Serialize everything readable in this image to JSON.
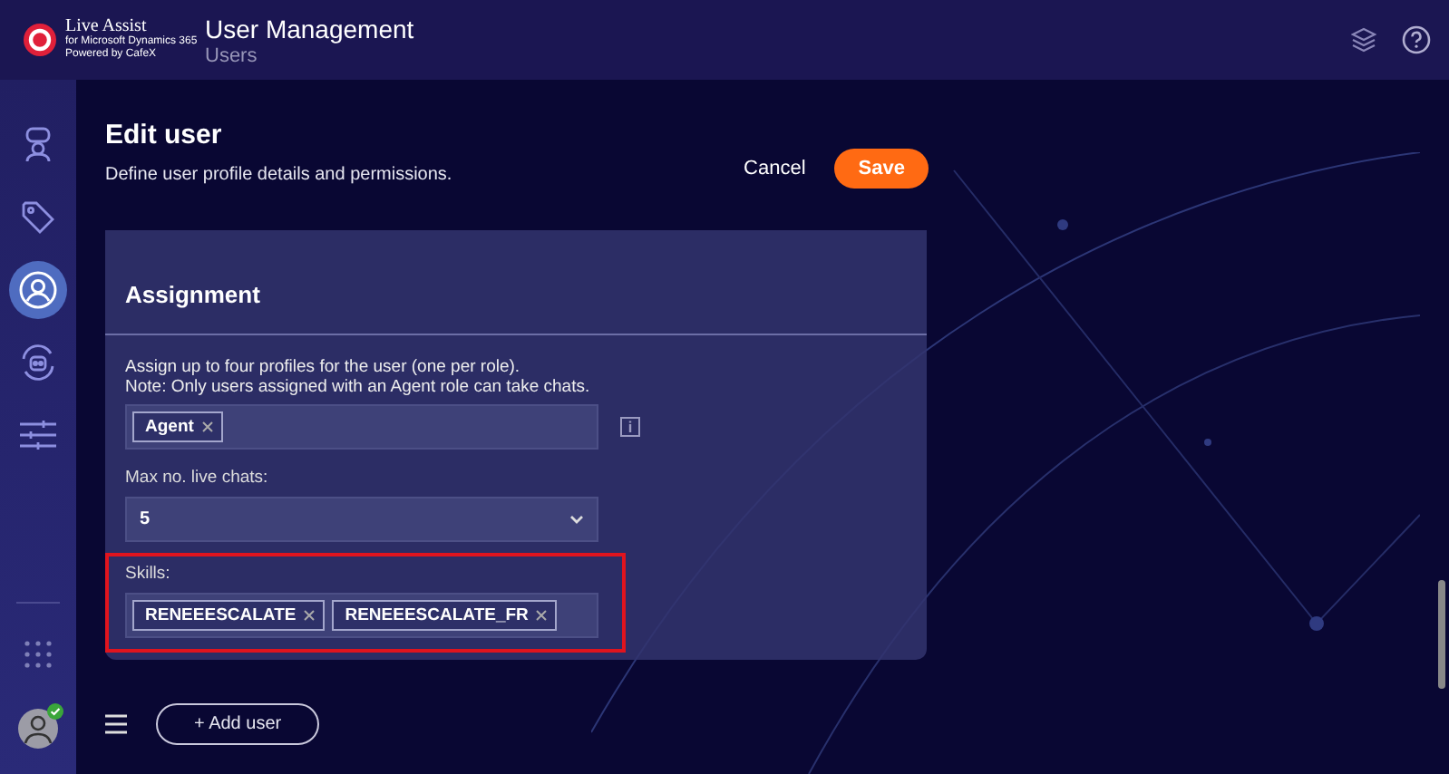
{
  "header": {
    "logo": {
      "name": "Live Assist",
      "line1": "for Microsoft Dynamics 365",
      "line2": "Powered by CafeX"
    },
    "title": "User Management",
    "subtitle": "Users"
  },
  "sidebar": {
    "items": [
      {
        "kind": "chat-user",
        "selected": false
      },
      {
        "kind": "tag",
        "selected": false
      },
      {
        "kind": "user",
        "selected": true
      },
      {
        "kind": "bot",
        "selected": false
      },
      {
        "kind": "sliders",
        "selected": false
      }
    ],
    "user_online": true
  },
  "page": {
    "title": "Edit user",
    "description": "Define user profile details and permissions.",
    "cancel": "Cancel",
    "save": "Save"
  },
  "section": {
    "title": "Assignment",
    "help": [
      "Assign up to four profiles for the user (one per role).",
      "Note: Only users assigned with an Agent role can take chats."
    ],
    "roles": [
      "Agent"
    ],
    "max_chats": {
      "label": "Max no. live chats:",
      "value": "5"
    },
    "skills": {
      "label": "Skills:",
      "tags": [
        "RENEEESCALATE",
        "RENEEESCALATE_FR"
      ],
      "highlighted": true
    }
  },
  "footer": {
    "add_user": "+ Add user"
  }
}
